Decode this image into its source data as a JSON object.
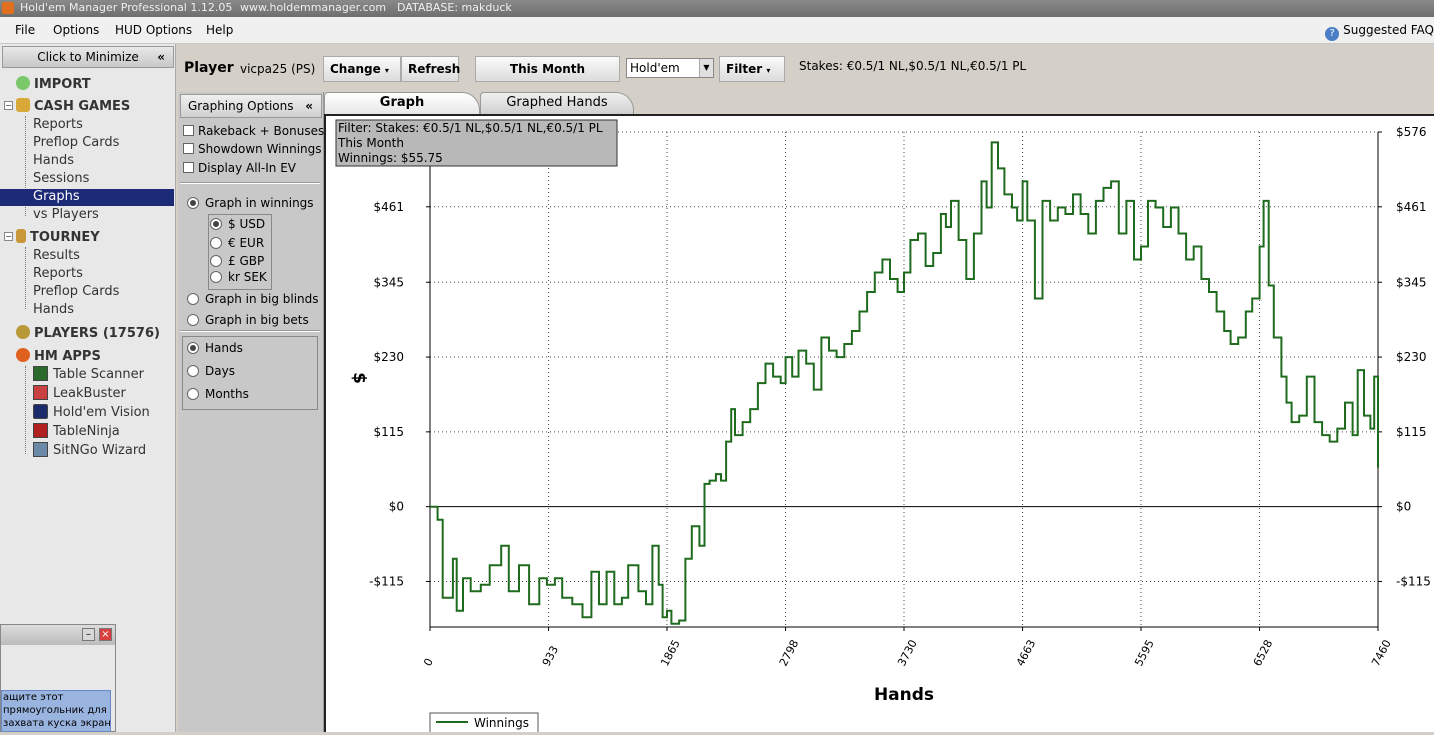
{
  "window": {
    "title": "Hold'em Manager Professional 1.12.05",
    "website": "www.holdemmanager.com",
    "database": "DATABASE: makduck"
  },
  "menu": [
    "File",
    "Options",
    "HUD Options",
    "Help"
  ],
  "suggested": "Suggested FAQ",
  "sidebar": {
    "minimize": "Click to Minimize",
    "import": "IMPORT",
    "cash_games": "CASH GAMES",
    "cash_items": [
      "Reports",
      "Preflop Cards",
      "Hands",
      "Sessions",
      "Graphs",
      "vs Players"
    ],
    "tourney": "TOURNEY",
    "tourney_items": [
      "Results",
      "Reports",
      "Preflop Cards",
      "Hands"
    ],
    "players": "PLAYERS (17576)",
    "hm_apps": "HM APPS",
    "apps": [
      "Table Scanner",
      "LeakBuster",
      "Hold'em Vision",
      "TableNinja",
      "SitNGo Wizard"
    ]
  },
  "popup": {
    "message_lines": [
      "ащите этот",
      "прямоугольник для",
      "захвата куска экрана."
    ]
  },
  "toolbar": {
    "player_label": "Player",
    "player_value": "vicpa25 (PS)",
    "change": "Change",
    "refresh": "Refresh",
    "period": "This Month",
    "game": "Hold'em",
    "filter": "Filter",
    "stakes": "Stakes: €0.5/1 NL,$0.5/1 NL,€0.5/1 PL"
  },
  "options": {
    "header": "Graphing Options",
    "rakeback": "Rakeback + Bonuses",
    "showdown": "Showdown Winnings",
    "allin": "Display All-In EV",
    "graph_winnings": "Graph in winnings",
    "currencies": [
      "$ USD",
      "€ EUR",
      "£ GBP",
      "kr SEK"
    ],
    "graph_bb": "Graph in big blinds",
    "graph_bets": "Graph in big bets",
    "x_modes": [
      "Hands",
      "Days",
      "Months"
    ]
  },
  "tabs": [
    "Graph",
    "Graphed Hands"
  ],
  "chart_data": {
    "type": "line",
    "info_lines": [
      "Filter: Stakes: €0.5/1 NL,$0.5/1 NL,€0.5/1 PL",
      "This Month",
      "Winnings: $55.75"
    ],
    "xlabel": "Hands",
    "ylabel": "$",
    "x_ticks": [
      0,
      933,
      1865,
      2798,
      3730,
      4663,
      5595,
      6528,
      7460
    ],
    "y_ticks": [
      -115,
      0,
      115,
      230,
      345,
      461,
      576
    ],
    "y_tick_labels": [
      "-$115",
      "$0",
      "$115",
      "$230",
      "$345",
      "$461",
      "$576"
    ],
    "xlim": [
      0,
      7460
    ],
    "ylim": [
      -185,
      576
    ],
    "grid": true,
    "legend": "bottom-left",
    "series": [
      {
        "name": "Winnings",
        "color": "#1e6b1e",
        "x": [
          0,
          60,
          100,
          180,
          210,
          260,
          320,
          400,
          470,
          560,
          620,
          700,
          780,
          860,
          920,
          983,
          1040,
          1120,
          1200,
          1270,
          1330,
          1390,
          1450,
          1510,
          1560,
          1640,
          1700,
          1750,
          1800,
          1830,
          1865,
          1900,
          1960,
          2010,
          2060,
          2120,
          2160,
          2200,
          2250,
          2290,
          2330,
          2370,
          2400,
          2460,
          2520,
          2580,
          2640,
          2700,
          2760,
          2798,
          2850,
          2900,
          2960,
          3020,
          3080,
          3140,
          3200,
          3260,
          3320,
          3380,
          3440,
          3500,
          3560,
          3620,
          3680,
          3730,
          3780,
          3840,
          3900,
          3960,
          4020,
          4060,
          4100,
          4160,
          4220,
          4280,
          4340,
          4380,
          4420,
          4470,
          4520,
          4580,
          4620,
          4663,
          4700,
          4760,
          4820,
          4880,
          4940,
          5000,
          5060,
          5120,
          5180,
          5240,
          5300,
          5360,
          5420,
          5480,
          5540,
          5595,
          5650,
          5710,
          5770,
          5830,
          5890,
          5950,
          6010,
          6070,
          6130,
          6190,
          6250,
          6300,
          6360,
          6420,
          6470,
          6528,
          6560,
          6600,
          6640,
          6700,
          6740,
          6780,
          6840,
          6900,
          6960,
          7020,
          7080,
          7140,
          7200,
          7260,
          7300,
          7350,
          7400,
          7430,
          7460
        ],
        "y": [
          0,
          -20,
          -140,
          -80,
          -160,
          -110,
          -130,
          -120,
          -90,
          -60,
          -130,
          -90,
          -150,
          -110,
          -120,
          -110,
          -140,
          -150,
          -170,
          -100,
          -150,
          -100,
          -150,
          -140,
          -90,
          -130,
          -150,
          -60,
          -120,
          -170,
          -160,
          -180,
          -175,
          -80,
          -30,
          -60,
          35,
          40,
          50,
          40,
          100,
          150,
          110,
          130,
          150,
          190,
          220,
          200,
          190,
          230,
          200,
          240,
          220,
          180,
          260,
          240,
          230,
          250,
          270,
          300,
          330,
          360,
          380,
          350,
          330,
          360,
          410,
          420,
          370,
          390,
          450,
          430,
          470,
          410,
          350,
          420,
          500,
          460,
          560,
          520,
          480,
          460,
          440,
          500,
          440,
          320,
          470,
          440,
          460,
          450,
          480,
          450,
          420,
          470,
          490,
          500,
          420,
          470,
          380,
          400,
          470,
          460,
          430,
          460,
          420,
          380,
          400,
          350,
          330,
          300,
          270,
          250,
          260,
          300,
          320,
          400,
          470,
          340,
          260,
          200,
          160,
          130,
          140,
          200,
          130,
          110,
          100,
          120,
          160,
          110,
          210,
          140,
          120,
          200,
          60
        ]
      }
    ]
  }
}
